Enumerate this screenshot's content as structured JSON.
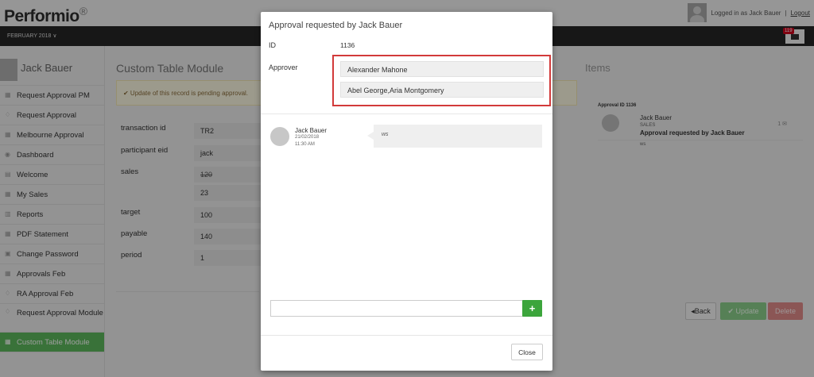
{
  "header": {
    "logo": "Performio",
    "logo_mark": "®",
    "logged_in_text": "Logged in as Jack Bauer",
    "separator": "|",
    "logout": "Logout"
  },
  "navbar": {
    "period": "FEBRUARY 2018 ∨",
    "mail_badge": "119"
  },
  "sidebar": {
    "user_name": "Jack Bauer",
    "items": [
      {
        "label": "Request Approval PM",
        "icon": "grid-icon"
      },
      {
        "label": "Request Approval",
        "icon": "thumbs-up-icon"
      },
      {
        "label": "Melbourne Approval",
        "icon": "grid-icon"
      },
      {
        "label": "Dashboard",
        "icon": "dashboard-icon"
      },
      {
        "label": "Welcome",
        "icon": "document-icon"
      },
      {
        "label": "My Sales",
        "icon": "grid-icon"
      },
      {
        "label": "Reports",
        "icon": "bar-chart-icon"
      },
      {
        "label": "PDF Statement",
        "icon": "grid-icon"
      },
      {
        "label": "Change Password",
        "icon": "lock-icon"
      },
      {
        "label": "Approvals Feb",
        "icon": "grid-icon"
      },
      {
        "label": "RA Approval Feb",
        "icon": "thumbs-up-icon"
      },
      {
        "label": "Request Approval Module",
        "icon": "thumbs-up-icon"
      },
      {
        "label": "Custom Table Module",
        "icon": "grid-icon"
      }
    ]
  },
  "main": {
    "title": "Custom Table Module",
    "pending_message": "✔ Update of this record is pending approval.",
    "fields": [
      {
        "label": "transaction id",
        "value": "TR2"
      },
      {
        "label": "participant eid",
        "value": "jack"
      },
      {
        "label": "sales",
        "old_value": "120",
        "value": "23"
      },
      {
        "label": "target",
        "value": "100"
      },
      {
        "label": "payable",
        "value": "140"
      },
      {
        "label": "period",
        "value": "1"
      }
    ],
    "back_button": "◂Back",
    "update_button": "✔ Update",
    "delete_button": "Delete"
  },
  "items": {
    "title": "Items",
    "card": {
      "approval_id": "Approval ID 1136",
      "name": "Jack Bauer",
      "dept": "SALES",
      "message": "Approval requested by Jack Bauer",
      "note": "ws",
      "count": "1"
    }
  },
  "modal": {
    "title": "Approval requested by Jack Bauer",
    "id_label": "ID",
    "id_value": "1136",
    "approver_label": "Approver",
    "approvers": [
      "Alexander Mahone",
      "Abel George,Aria Montgomery"
    ],
    "comment": {
      "author": "Jack Bauer",
      "date": "21/02/2018",
      "time": "11:30 AM",
      "text": "ws"
    },
    "add_button": "+",
    "close_button": "Close",
    "comment_input_value": ""
  }
}
